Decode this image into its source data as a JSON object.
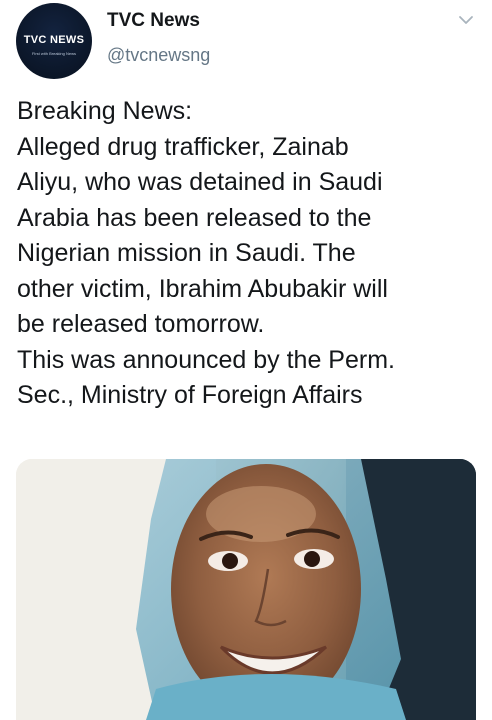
{
  "account": {
    "display_name": "TVC News",
    "handle": "@tvcnewsng",
    "avatar_logo": "TVC NEWS",
    "avatar_tagline": "First with Breaking News"
  },
  "tweet": {
    "lines": [
      "Breaking News:",
      "Alleged drug trafficker, Zainab",
      "Aliyu, who was detained in Saudi",
      "Arabia has been released to the",
      "Nigerian mission in Saudi. The",
      "other victim, Ibrahim Abubakir will",
      "be released tomorrow.",
      "This was announced by the Perm.",
      "Sec., Ministry of Foreign Affairs"
    ]
  },
  "icons": {
    "menu": "chevron-down-icon"
  },
  "colors": {
    "text_primary": "#14171a",
    "text_secondary": "#657786",
    "avatar_bg": "#0b1628"
  }
}
